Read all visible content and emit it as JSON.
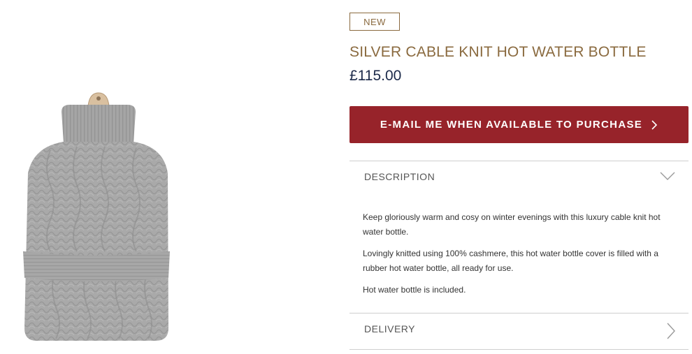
{
  "product": {
    "badge": "NEW",
    "title": "SILVER CABLE KNIT HOT WATER BOTTLE",
    "price": "£115.00",
    "image_alt": "Silver cable knit hot water bottle"
  },
  "actions": {
    "notify_label": "E-MAIL ME WHEN AVAILABLE TO PURCHASE",
    "notify_icon": "chevron-right-icon"
  },
  "accordion": {
    "description": {
      "label": "DESCRIPTION",
      "state": "expanded",
      "icon": "chevron-down-icon",
      "paragraphs": [
        "Keep gloriously warm and cosy on winter evenings with this luxury cable knit hot water bottle.",
        "Lovingly knitted using 100% cashmere, this hot water bottle cover is filled with a rubber hot water bottle, all ready for use.",
        "Hot water bottle is included."
      ]
    },
    "delivery": {
      "label": "DELIVERY",
      "state": "collapsed",
      "icon": "chevron-right-icon"
    }
  },
  "colors": {
    "brand_gold": "#8a6a3f",
    "button_red": "#97232a",
    "price_navy": "#1c2a4a",
    "divider": "#cfcfcf"
  }
}
